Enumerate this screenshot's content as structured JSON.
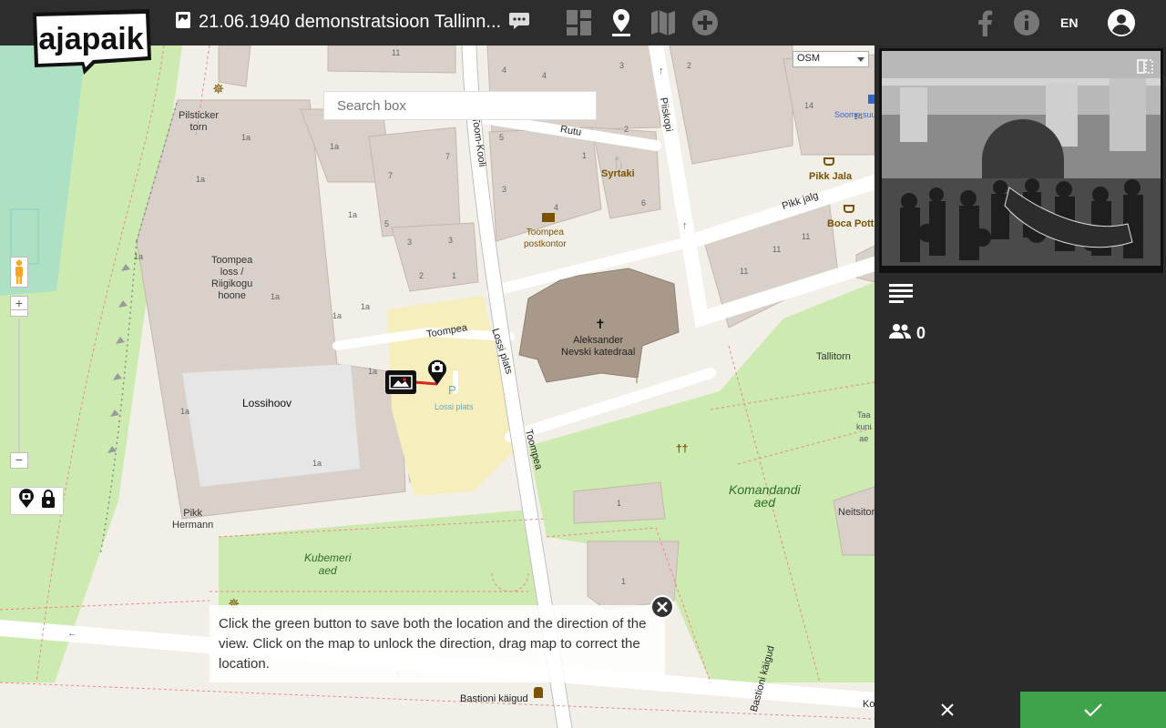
{
  "header": {
    "logo_text": "ajapaik",
    "title": "21.06.1940 demonstratsioon Tallinn...",
    "language": "EN",
    "icons": [
      "photo-icon",
      "comment-icon",
      "grid-icon",
      "map-pin-icon",
      "map-icon",
      "add-icon",
      "facebook-icon",
      "info-icon",
      "account-icon"
    ]
  },
  "map": {
    "search_placeholder": "Search box",
    "layer_select": "OSM",
    "zoom_in": "+",
    "zoom_out": "−",
    "labels": {
      "pilsticker": "Pilsticker\ntorn",
      "toompea_loss": "Toompea\nloss /\nRiigikogu\nhoone",
      "lossihoov": "Lossihoov",
      "pikk_hermann": "Pikk\nHermann",
      "kubemeri": "Kubemeri\naed",
      "toompea_street": "Toompea",
      "lossi_plats_street": "Lossi plats",
      "toompea_street2": "Toompea",
      "lossi_plats": "Lossi plats",
      "parking": "P",
      "cathedral": "Aleksander\nNevski katedraal",
      "syrtaki": "Syrtaki",
      "postkontor": "Toompea\npostkontor",
      "pikk_jala": "Pikk Jala",
      "boca_pott": "Boca Pott",
      "pikk_jalg": "Pikk jalg",
      "piiskopi": "Piiskopi",
      "rutu": "Rutu",
      "toom_kooli": "Toom-Kooli",
      "tallitorn": "Tallitorn",
      "komandandi": "Komandandi\naed",
      "neitsitorn": "Neitsitorn",
      "taani": "Taa\nkuni\nae",
      "soome": "Soome suu",
      "bastioni_kaigud": "Bastioni käigud",
      "bastioni_kaigud2": "Bastioni käigud",
      "ko": "Ko"
    },
    "house_numbers": [
      "11",
      "4",
      "4",
      "3",
      "2",
      "3",
      "1a",
      "1a",
      "1a",
      "1a",
      "1a",
      "1a",
      "1a",
      "1a",
      "1a",
      "1a",
      "1a",
      "7",
      "5",
      "3",
      "1",
      "3",
      "2",
      "1",
      "3",
      "5",
      "7",
      "6",
      "4",
      "2",
      "14",
      "14",
      "11",
      "11",
      "11",
      "1",
      "1",
      "i",
      "i",
      "4"
    ],
    "info_text": "Click the green button to save both the location and the direction of the view. Click on the map to unlock the direction, drag map to correct the location."
  },
  "sidebar": {
    "people_count": "0"
  },
  "colors": {
    "save_green": "#3fa34a",
    "topbar": "#2d2d2d",
    "panel": "#2b2b2b",
    "map_bg": "#f2efe9"
  }
}
